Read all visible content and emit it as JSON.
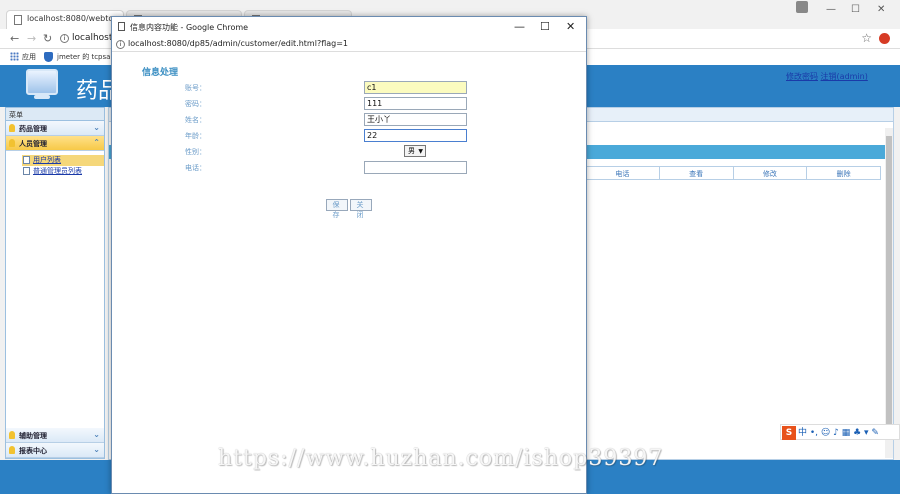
{
  "browser": {
    "tabs": [
      {
        "label": "localhost:8080/webto"
      },
      {
        "label": ""
      },
      {
        "label": ""
      }
    ],
    "address": "localhost",
    "bookmarks": {
      "apps": "应用",
      "jmeter": "jmeter 的 tcpsa"
    }
  },
  "app": {
    "title": "药品",
    "user_links": {
      "modify_password": "修改密码",
      "logout": "注销(admin)"
    }
  },
  "sidebar": {
    "title": "菜单",
    "groups": [
      {
        "label": "药品管理"
      },
      {
        "label": "人员管理"
      },
      {
        "label": "辅助管理"
      },
      {
        "label": "报表中心"
      }
    ],
    "items": [
      {
        "label": "用户列表"
      },
      {
        "label": "普通管理员列表"
      }
    ]
  },
  "main": {
    "columns": [
      "电话",
      "查看",
      "修改",
      "删除"
    ]
  },
  "popup": {
    "title": "信息内容功能 - Google Chrome",
    "url": "localhost:8080/dp85/admin/customer/edit.html?flag=1",
    "heading": "信息处理",
    "fields": {
      "account": {
        "label": "账号：",
        "value": "c1"
      },
      "password": {
        "label": "密码：",
        "value": "111"
      },
      "name": {
        "label": "姓名：",
        "value": "王小丫"
      },
      "age": {
        "label": "年龄：",
        "value": "22"
      },
      "gender": {
        "label": "性别：",
        "value": "男"
      },
      "phone": {
        "label": "电话：",
        "value": ""
      }
    },
    "save_label": "保 存",
    "close_label": "关 闭"
  },
  "ime": {
    "label": "中 •, ☺ ♪ ▦ ♣ ▾ ✎"
  },
  "watermark": "https://www.huzhan.com/ishop39397"
}
